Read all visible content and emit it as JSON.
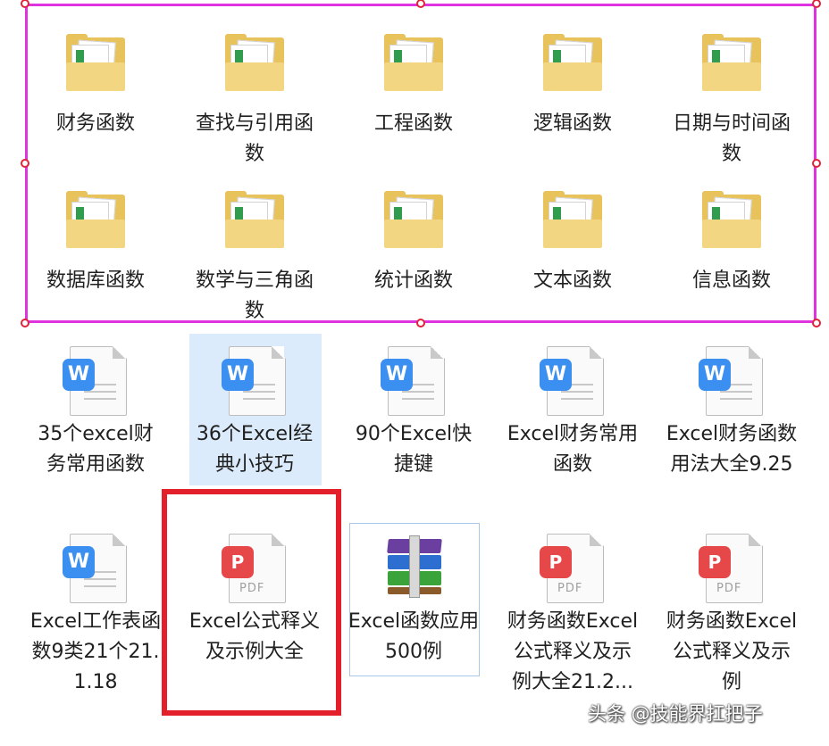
{
  "folders": [
    {
      "label": "财务函数"
    },
    {
      "label": "查找与引用函数"
    },
    {
      "label": "工程函数"
    },
    {
      "label": "逻辑函数"
    },
    {
      "label": "日期与时间函数"
    },
    {
      "label": "数据库函数"
    },
    {
      "label": "数学与三角函数"
    },
    {
      "label": "统计函数"
    },
    {
      "label": "文本函数"
    },
    {
      "label": "信息函数"
    }
  ],
  "files": [
    {
      "label": "35个excel财务常用函数",
      "type": "word",
      "icon_letter": "W"
    },
    {
      "label": "36个Excel经典小技巧",
      "type": "word",
      "icon_letter": "W"
    },
    {
      "label": "90个Excel快捷键",
      "type": "word",
      "icon_letter": "W"
    },
    {
      "label": "Excel财务常用函数",
      "type": "word",
      "icon_letter": "W"
    },
    {
      "label": "Excel财务函数用法大全9.25",
      "type": "word",
      "icon_letter": "W"
    },
    {
      "label": "Excel工作表函数9类21个21.1.18",
      "type": "word",
      "icon_letter": "W"
    },
    {
      "label": "Excel公式释义及示例大全",
      "type": "pdf",
      "icon_letter": "P",
      "icon_text": "PDF"
    },
    {
      "label": "Excel函数应用500例",
      "type": "archive"
    },
    {
      "label": "财务函数Excel公式释义及示例大全21.2...",
      "type": "pdf",
      "icon_letter": "P",
      "icon_text": "PDF"
    },
    {
      "label": "财务函数Excel公式释义及示例",
      "type": "pdf",
      "icon_letter": "P",
      "icon_text": "PDF"
    }
  ],
  "watermark": "头条 @技能界扛把子",
  "colors": {
    "selection_magenta": "#e033e0",
    "selection_red": "#e21f2a",
    "hover_blue": "#dcebfb",
    "word_blue": "#3a8ff0",
    "pdf_red": "#e6484a"
  }
}
